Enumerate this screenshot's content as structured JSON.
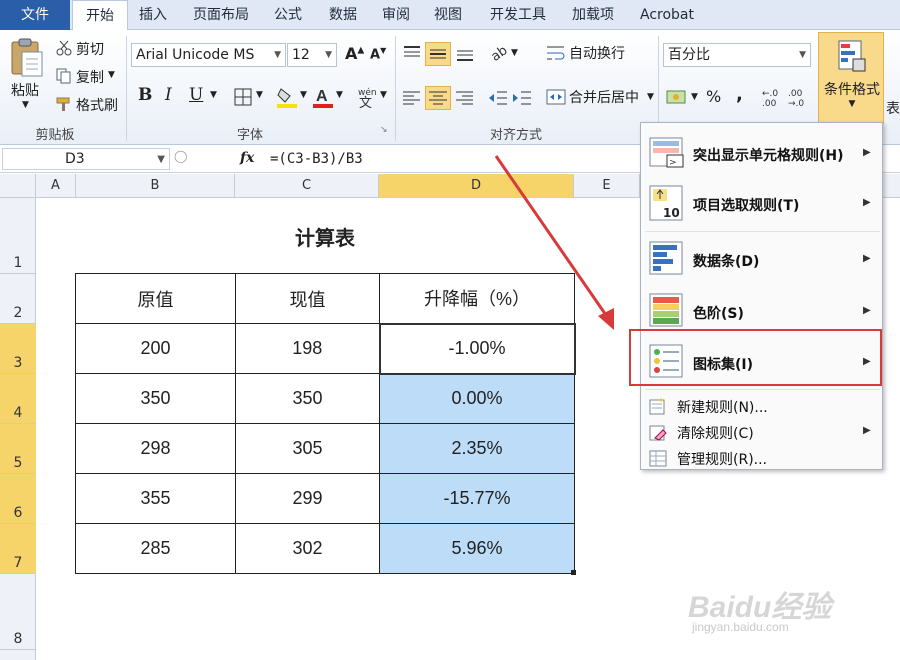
{
  "tabs": [
    "文件",
    "开始",
    "插入",
    "页面布局",
    "公式",
    "数据",
    "审阅",
    "视图",
    "开发工具",
    "加载项",
    "Acrobat"
  ],
  "clipboard": {
    "paste": "粘贴",
    "cut": "剪切",
    "copy": "复制",
    "format_painter": "格式刷",
    "group": "剪贴板"
  },
  "font": {
    "name": "Arial Unicode MS",
    "size": "12",
    "group": "字体",
    "bold": "B",
    "italic": "I",
    "underline": "U"
  },
  "alignment": {
    "wrap_text": "自动换行",
    "merge_center": "合并后居中",
    "group": "对齐方式"
  },
  "number": {
    "format": "百分比",
    "percent": "%",
    "comma": ","
  },
  "styles": {
    "conditional_format": "条件格式",
    "table_partial": "表"
  },
  "formula_bar": {
    "name_box": "D3",
    "fx": "fx",
    "formula": "=(C3-B3)/B3"
  },
  "columns": [
    "A",
    "B",
    "C",
    "D",
    "E"
  ],
  "rows": [
    "1",
    "2",
    "3",
    "4",
    "5",
    "6",
    "7",
    "8"
  ],
  "sheet": {
    "title": "计算表",
    "headers": [
      "原值",
      "现值",
      "升降幅（%）"
    ],
    "rows": [
      [
        "200",
        "198",
        "-1.00%"
      ],
      [
        "350",
        "350",
        "0.00%"
      ],
      [
        "298",
        "305",
        "2.35%"
      ],
      [
        "355",
        "299",
        "-15.77%"
      ],
      [
        "285",
        "302",
        "5.96%"
      ]
    ]
  },
  "menu": {
    "items": [
      "突出显示单元格规则(H)",
      "项目选取规则(T)",
      "数据条(D)",
      "色阶(S)",
      "图标集(I)",
      "新建规则(N)...",
      "清除规则(C)",
      "管理规则(R)..."
    ]
  },
  "watermark": {
    "brand": "Baidu经验",
    "url": "jingyan.baidu.com"
  },
  "colors": {
    "highlight_red": "#d83a3a",
    "selected_fill": "#bcdcf8",
    "accent_blue": "#2a5ea8"
  }
}
